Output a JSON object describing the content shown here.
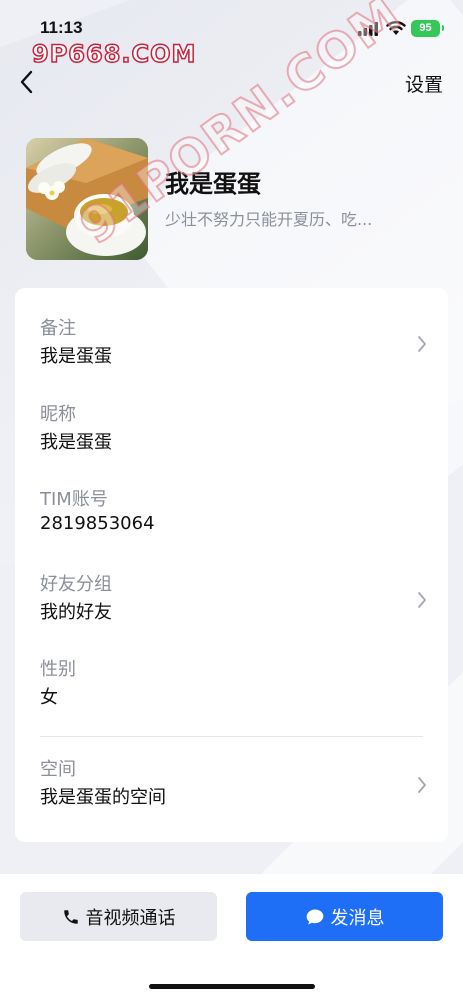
{
  "status_bar": {
    "time": "11:13",
    "battery": "95",
    "icons": [
      "signal-icon",
      "wifi-icon",
      "battery-icon"
    ]
  },
  "watermarks": {
    "top": "9P668.COM",
    "diagonal": "91PORN.COM"
  },
  "nav": {
    "back_icon": "chevron-left-icon",
    "settings_label": "设置"
  },
  "profile": {
    "name": "我是蛋蛋",
    "signature": "少壮不努力只能开夏历、吃..."
  },
  "info_rows": [
    {
      "label": "备注",
      "value": "我是蛋蛋",
      "has_chevron": true
    },
    {
      "label": "昵称",
      "value": "我是蛋蛋",
      "has_chevron": false
    },
    {
      "label": "TIM账号",
      "value": "2819853064",
      "has_chevron": false
    },
    {
      "label": "好友分组",
      "value": "我的好友",
      "has_chevron": true
    },
    {
      "label": "性别",
      "value": "女",
      "has_chevron": false
    },
    {
      "label": "空间",
      "value": "我是蛋蛋的空间",
      "has_chevron": true
    }
  ],
  "actions": {
    "call_label": "音视频通话",
    "call_icon": "phone-icon",
    "message_label": "发消息",
    "message_icon": "chat-bubble-icon"
  },
  "colors": {
    "accent": "#1e6ff5",
    "battery": "#35c759",
    "secondary_text": "#8b8f99"
  }
}
